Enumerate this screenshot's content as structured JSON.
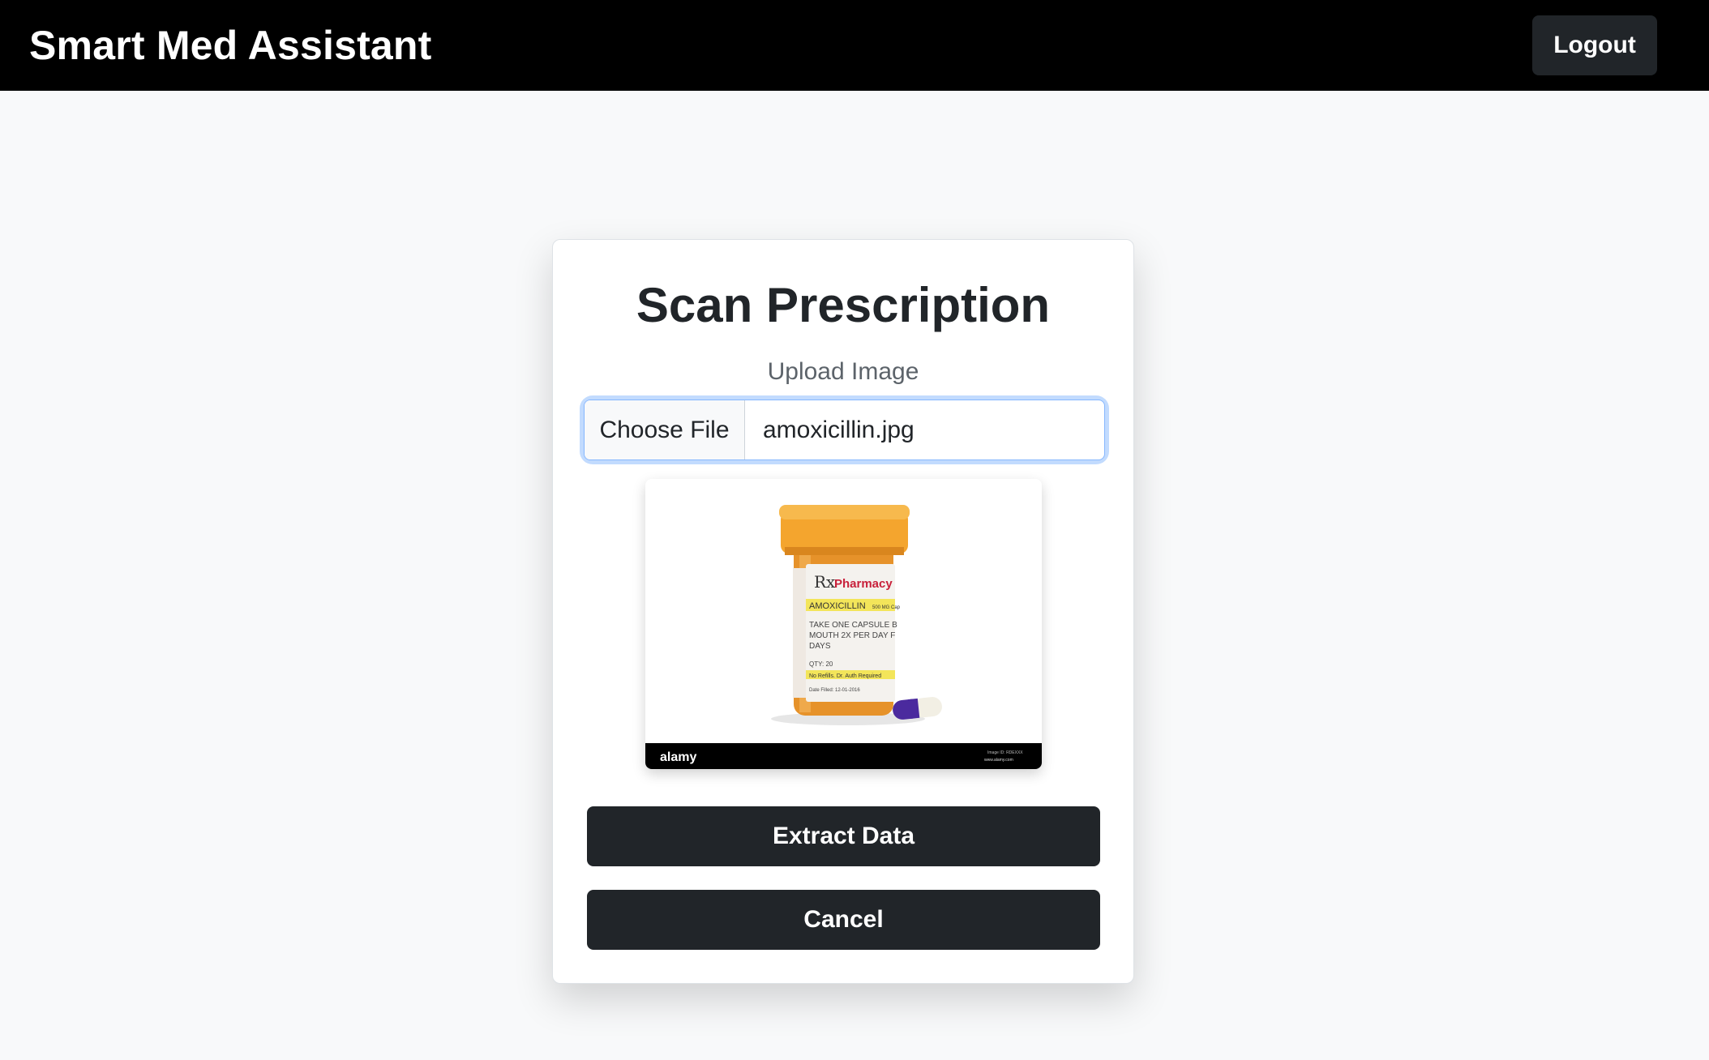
{
  "navbar": {
    "brand": "Smart Med Assistant",
    "logout_label": "Logout"
  },
  "card": {
    "title": "Scan Prescription",
    "upload_label": "Upload Image",
    "file_input": {
      "button_label": "Choose File",
      "file_name": "amoxicillin.jpg"
    },
    "preview": {
      "label_pharmacy": "Pharmacy",
      "label_rx": "Rx",
      "label_drug": "AMOXICILLIN",
      "label_dose": "500 MG Cap",
      "label_instr_1": "TAKE ONE CAPSULE B",
      "label_instr_2": "MOUTH 2X PER DAY F",
      "label_instr_3": "DAYS",
      "label_qty": "QTY: 20",
      "label_refills": "No Refills.  Dr. Auth Required",
      "label_date": "Date Filled: 12-01-2016",
      "watermark": "alamy",
      "watermark_id": "Image ID: RDEXXX",
      "watermark_site": "www.alamy.com"
    },
    "extract_label": "Extract Data",
    "cancel_label": "Cancel"
  },
  "colors": {
    "navbar_bg": "#000000",
    "button_dark": "#212529",
    "page_bg": "#f8f9fa",
    "focus_ring": "#86b7fe",
    "bottle_orange": "#f0a030"
  }
}
